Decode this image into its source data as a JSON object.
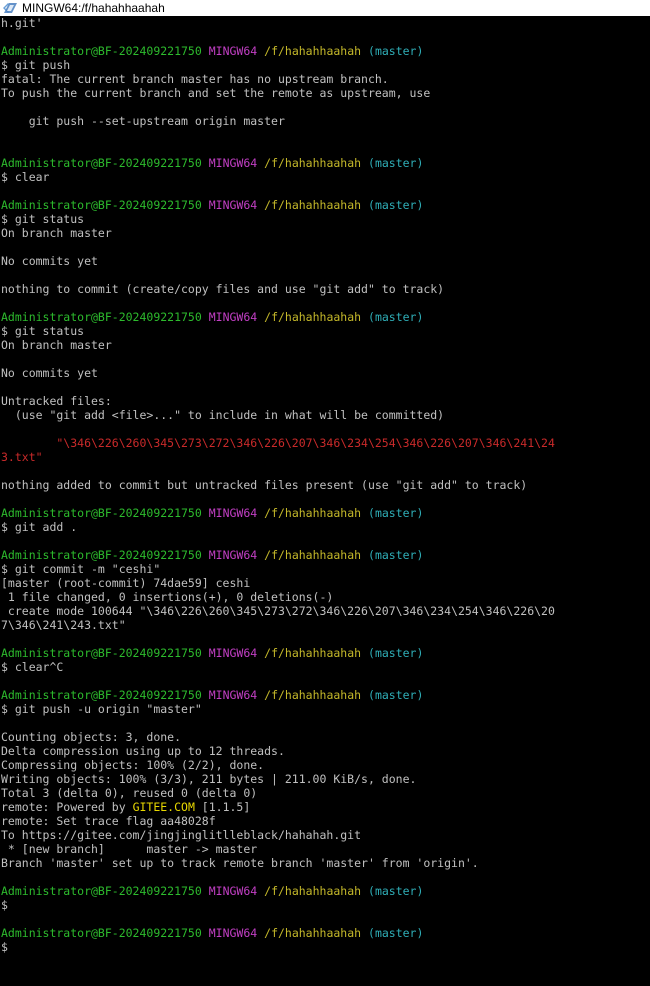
{
  "window": {
    "title": "MINGW64:/f/hahahhaahah",
    "icon": "git-bash-icon"
  },
  "colors": {
    "background": "#000000",
    "text": "#c0c0c0",
    "user": "#2dbb2d",
    "system": "#c23fc4",
    "path": "#c4b82a",
    "branch": "#2faeb7",
    "untracked": "#c92a2a",
    "highlight": "#e8d800"
  },
  "terminal": {
    "lines": [
      {
        "type": "text",
        "text": "h.git'"
      },
      {
        "type": "blank"
      },
      {
        "type": "prompt",
        "user": "Administrator@BF-202409221750",
        "system": "MINGW64",
        "path": "/f/hahahhaahah",
        "branch": "(master)"
      },
      {
        "type": "text",
        "text": "$ git push"
      },
      {
        "type": "text",
        "text": "fatal: The current branch master has no upstream branch."
      },
      {
        "type": "text",
        "text": "To push the current branch and set the remote as upstream, use"
      },
      {
        "type": "blank"
      },
      {
        "type": "text",
        "text": "    git push --set-upstream origin master"
      },
      {
        "type": "blank"
      },
      {
        "type": "blank"
      },
      {
        "type": "prompt",
        "user": "Administrator@BF-202409221750",
        "system": "MINGW64",
        "path": "/f/hahahhaahah",
        "branch": "(master)"
      },
      {
        "type": "text",
        "text": "$ clear"
      },
      {
        "type": "blank"
      },
      {
        "type": "prompt",
        "user": "Administrator@BF-202409221750",
        "system": "MINGW64",
        "path": "/f/hahahhaahah",
        "branch": "(master)"
      },
      {
        "type": "text",
        "text": "$ git status"
      },
      {
        "type": "text",
        "text": "On branch master"
      },
      {
        "type": "blank"
      },
      {
        "type": "text",
        "text": "No commits yet"
      },
      {
        "type": "blank"
      },
      {
        "type": "text",
        "text": "nothing to commit (create/copy files and use \"git add\" to track)"
      },
      {
        "type": "blank"
      },
      {
        "type": "prompt",
        "user": "Administrator@BF-202409221750",
        "system": "MINGW64",
        "path": "/f/hahahhaahah",
        "branch": "(master)"
      },
      {
        "type": "text",
        "text": "$ git status"
      },
      {
        "type": "text",
        "text": "On branch master"
      },
      {
        "type": "blank"
      },
      {
        "type": "text",
        "text": "No commits yet"
      },
      {
        "type": "blank"
      },
      {
        "type": "text",
        "text": "Untracked files:"
      },
      {
        "type": "text",
        "text": "  (use \"git add <file>...\" to include in what will be committed)"
      },
      {
        "type": "blank"
      },
      {
        "type": "red",
        "text": "        \"\\346\\226\\260\\345\\273\\272\\346\\226\\207\\346\\234\\254\\346\\226\\207\\346\\241\\24"
      },
      {
        "type": "red",
        "text": "3.txt\""
      },
      {
        "type": "blank"
      },
      {
        "type": "text",
        "text": "nothing added to commit but untracked files present (use \"git add\" to track)"
      },
      {
        "type": "blank"
      },
      {
        "type": "prompt",
        "user": "Administrator@BF-202409221750",
        "system": "MINGW64",
        "path": "/f/hahahhaahah",
        "branch": "(master)"
      },
      {
        "type": "text",
        "text": "$ git add ."
      },
      {
        "type": "blank"
      },
      {
        "type": "prompt",
        "user": "Administrator@BF-202409221750",
        "system": "MINGW64",
        "path": "/f/hahahhaahah",
        "branch": "(master)"
      },
      {
        "type": "text",
        "text": "$ git commit -m \"ceshi\""
      },
      {
        "type": "text",
        "text": "[master (root-commit) 74dae59] ceshi"
      },
      {
        "type": "text",
        "text": " 1 file changed, 0 insertions(+), 0 deletions(-)"
      },
      {
        "type": "text",
        "text": " create mode 100644 \"\\346\\226\\260\\345\\273\\272\\346\\226\\207\\346\\234\\254\\346\\226\\20"
      },
      {
        "type": "text",
        "text": "7\\346\\241\\243.txt\""
      },
      {
        "type": "blank"
      },
      {
        "type": "prompt",
        "user": "Administrator@BF-202409221750",
        "system": "MINGW64",
        "path": "/f/hahahhaahah",
        "branch": "(master)"
      },
      {
        "type": "text",
        "text": "$ clear^C"
      },
      {
        "type": "blank"
      },
      {
        "type": "prompt",
        "user": "Administrator@BF-202409221750",
        "system": "MINGW64",
        "path": "/f/hahahhaahah",
        "branch": "(master)"
      },
      {
        "type": "text",
        "text": "$ git push -u origin \"master\""
      },
      {
        "type": "blank"
      },
      {
        "type": "text",
        "text": "Counting objects: 3, done."
      },
      {
        "type": "text",
        "text": "Delta compression using up to 12 threads."
      },
      {
        "type": "text",
        "text": "Compressing objects: 100% (2/2), done."
      },
      {
        "type": "text",
        "text": "Writing objects: 100% (3/3), 211 bytes | 211.00 KiB/s, done."
      },
      {
        "type": "text",
        "text": "Total 3 (delta 0), reused 0 (delta 0)"
      },
      {
        "type": "powered",
        "pre": "remote: Powered by ",
        "hl": "GITEE.COM",
        "post": " [1.1.5]"
      },
      {
        "type": "text",
        "text": "remote: Set trace flag aa48028f"
      },
      {
        "type": "text",
        "text": "To https://gitee.com/jingjinglitlleblack/hahahah.git"
      },
      {
        "type": "text",
        "text": " * [new branch]      master -> master"
      },
      {
        "type": "text",
        "text": "Branch 'master' set up to track remote branch 'master' from 'origin'."
      },
      {
        "type": "blank"
      },
      {
        "type": "prompt",
        "user": "Administrator@BF-202409221750",
        "system": "MINGW64",
        "path": "/f/hahahhaahah",
        "branch": "(master)"
      },
      {
        "type": "text",
        "text": "$"
      },
      {
        "type": "blank"
      },
      {
        "type": "prompt",
        "user": "Administrator@BF-202409221750",
        "system": "MINGW64",
        "path": "/f/hahahhaahah",
        "branch": "(master)"
      },
      {
        "type": "text",
        "text": "$"
      }
    ]
  }
}
